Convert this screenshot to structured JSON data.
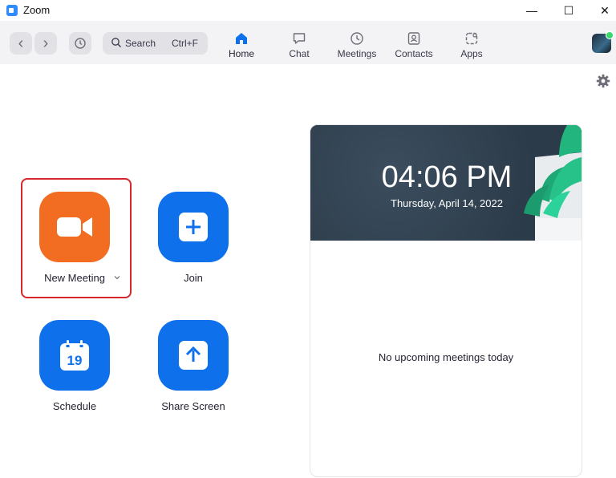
{
  "window": {
    "title": "Zoom",
    "minimize": "—",
    "maximize": "☐",
    "close": "✕"
  },
  "toolbar": {
    "back": "‹",
    "forward": "›",
    "search": {
      "label": "Search",
      "shortcut": "Ctrl+F"
    },
    "tabs": [
      {
        "label": "Home",
        "icon": "home-icon"
      },
      {
        "label": "Chat",
        "icon": "chat-icon"
      },
      {
        "label": "Meetings",
        "icon": "clock-icon"
      },
      {
        "label": "Contacts",
        "icon": "contacts-icon"
      },
      {
        "label": "Apps",
        "icon": "apps-icon"
      }
    ],
    "active_tab": "Home"
  },
  "actions": [
    {
      "label": "New Meeting",
      "icon": "video-camera-icon",
      "color": "#F26D21",
      "has_dropdown": true
    },
    {
      "label": "Join",
      "icon": "plus-icon",
      "color": "#0E71EB"
    },
    {
      "label": "Schedule",
      "icon": "calendar-icon",
      "color": "#0E71EB",
      "calendar_day": "19"
    },
    {
      "label": "Share Screen",
      "icon": "share-arrow-icon",
      "color": "#0E71EB"
    }
  ],
  "meeting_panel": {
    "time": "04:06 PM",
    "date": "Thursday, April 14, 2022",
    "empty_message": "No upcoming meetings today"
  },
  "colors": {
    "accent": "#0E71EB",
    "new_meeting": "#F26D21",
    "highlight_border": "#D9262C",
    "toolbar_bg": "#F3F3F5"
  }
}
